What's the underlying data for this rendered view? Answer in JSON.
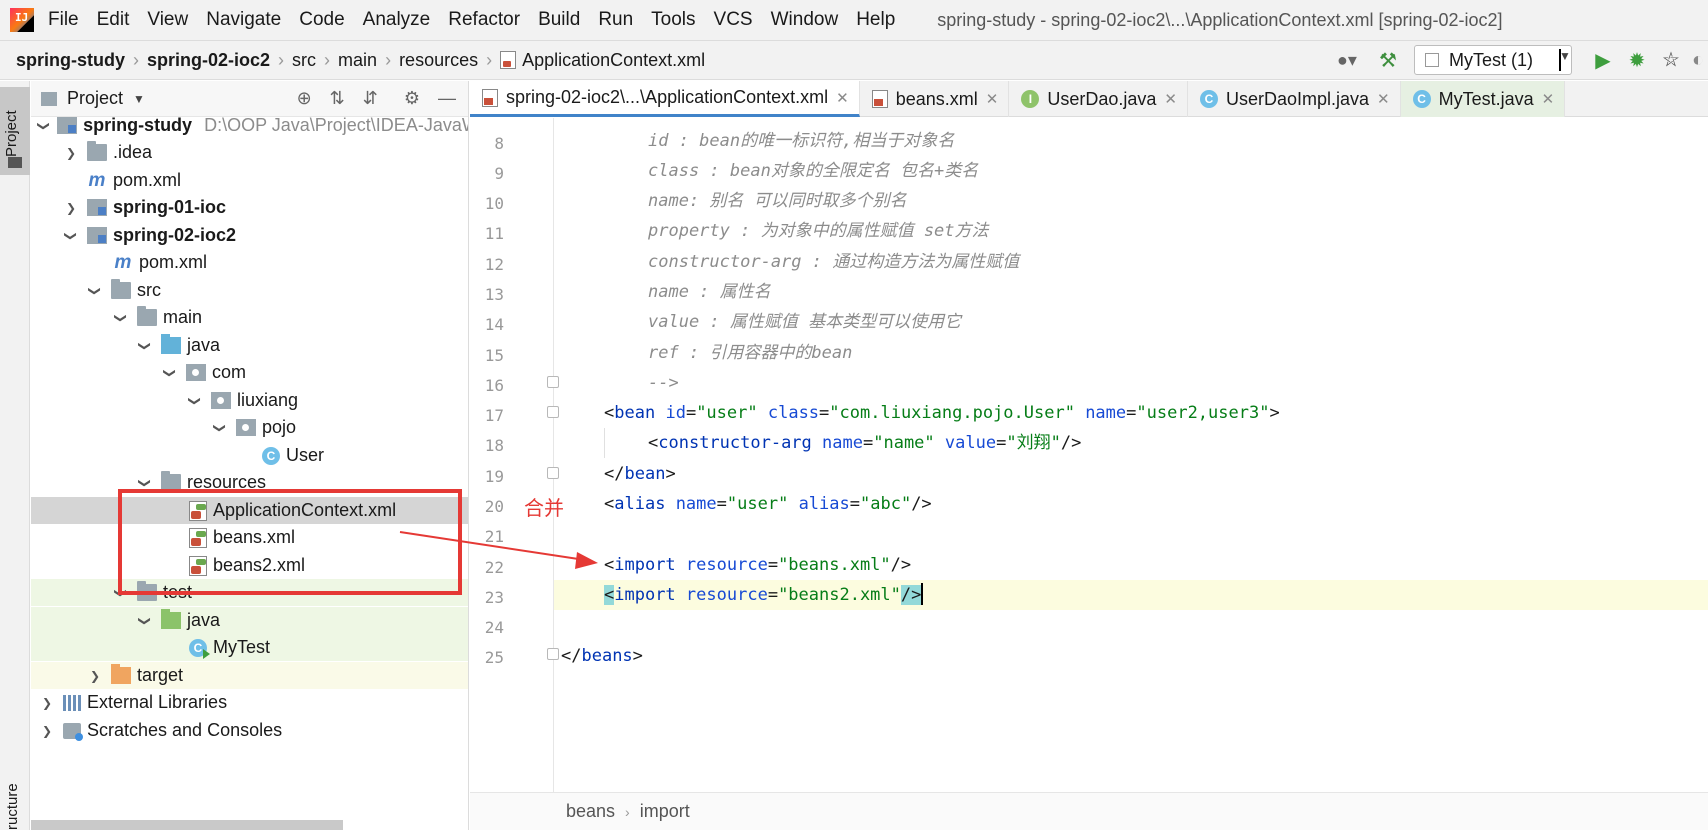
{
  "menubar": {
    "logo_text": "IJ",
    "items": [
      "File",
      "Edit",
      "View",
      "Navigate",
      "Code",
      "Analyze",
      "Refactor",
      "Build",
      "Run",
      "Tools",
      "VCS",
      "Window",
      "Help"
    ],
    "window_title": "spring-study - spring-02-ioc2\\...\\ApplicationContext.xml [spring-02-ioc2]"
  },
  "navbar": {
    "crumbs": [
      "spring-study",
      "spring-02-ioc2",
      "src",
      "main",
      "resources",
      "ApplicationContext.xml"
    ],
    "run_config": "MyTest (1)"
  },
  "left_strip": {
    "project_tab": "Project",
    "structure_tab": "ructure"
  },
  "project_panel": {
    "title": "Project",
    "tree": [
      {
        "label": "spring-study",
        "path": "D:\\OOP Java\\Project\\IDEA-JavaWeb",
        "bold": true
      },
      {
        "label": ".idea"
      },
      {
        "label": "pom.xml"
      },
      {
        "label": "spring-01-ioc",
        "bold": true
      },
      {
        "label": "spring-02-ioc2",
        "bold": true
      },
      {
        "label": "pom.xml"
      },
      {
        "label": "src"
      },
      {
        "label": "main"
      },
      {
        "label": "java"
      },
      {
        "label": "com"
      },
      {
        "label": "liuxiang"
      },
      {
        "label": "pojo"
      },
      {
        "label": "User"
      },
      {
        "label": "resources"
      },
      {
        "label": "ApplicationContext.xml"
      },
      {
        "label": "beans.xml"
      },
      {
        "label": "beans2.xml"
      },
      {
        "label": "test"
      },
      {
        "label": "java"
      },
      {
        "label": "MyTest"
      },
      {
        "label": "target"
      },
      {
        "label": "External Libraries"
      },
      {
        "label": "Scratches and Consoles"
      }
    ]
  },
  "editor": {
    "tabs": [
      {
        "label": "spring-02-ioc2\\...\\ApplicationContext.xml",
        "icon": "xml-file-icon"
      },
      {
        "label": "beans.xml",
        "icon": "xml-file-icon"
      },
      {
        "label": "UserDao.java",
        "icon": "interface-icon"
      },
      {
        "label": "UserDaoImpl.java",
        "icon": "class-icon"
      },
      {
        "label": "MyTest.java",
        "icon": "test-class-icon"
      }
    ],
    "class_glyph": "C",
    "interface_glyph": "I",
    "lines": [
      {
        "no": "8",
        "text": "id : bean的唯一标识符,相当于对象名"
      },
      {
        "no": "9",
        "text": "class : bean对象的全限定名 包名+类名"
      },
      {
        "no": "10",
        "text": "name: 别名 可以同时取多个别名"
      },
      {
        "no": "11",
        "text": "property : 为对象中的属性赋值 set方法"
      },
      {
        "no": "12",
        "text": "constructor-arg : 通过构造方法为属性赋值"
      },
      {
        "no": "13",
        "text": "name : 属性名"
      },
      {
        "no": "14",
        "text": "value : 属性赋值 基本类型可以使用它"
      },
      {
        "no": "15",
        "text": "ref : 引用容器中的bean"
      },
      {
        "no": "16",
        "text": "-->"
      },
      {
        "no": "17"
      },
      {
        "no": "18"
      },
      {
        "no": "19"
      },
      {
        "no": "20"
      },
      {
        "no": "21"
      },
      {
        "no": "22"
      },
      {
        "no": "23"
      },
      {
        "no": "24"
      },
      {
        "no": "25"
      }
    ],
    "xml": {
      "l17": {
        "tag": "bean",
        "a1": "id",
        "v1": "\"user\"",
        "a2": "class",
        "v2": "\"com.liuxiang.pojo.User\"",
        "a3": "name",
        "v3": "\"user2,user3\""
      },
      "l18": {
        "tag": "constructor-arg",
        "a1": "name",
        "v1": "\"name\"",
        "a2": "value",
        "v2": "\"刘翔\""
      },
      "l19": {
        "tag": "bean"
      },
      "l20": {
        "tag": "alias",
        "a1": "name",
        "v1": "\"user\"",
        "a2": "alias",
        "v2": "\"abc\""
      },
      "l22": {
        "tag": "import",
        "a1": "resource",
        "v1": "\"beans.xml\""
      },
      "l23": {
        "tag": "import",
        "a1": "resource",
        "v1": "\"beans2.xml\""
      },
      "l25": {
        "tag": "beans"
      }
    },
    "breadcrumb": [
      "beans",
      "import"
    ]
  },
  "annotation": {
    "label": "合并",
    "color": "#e53935"
  }
}
